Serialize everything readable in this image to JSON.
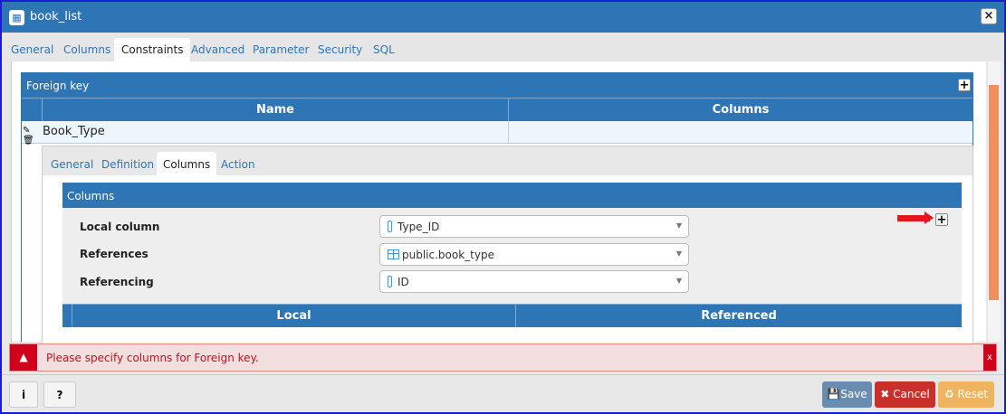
{
  "window": {
    "title": "book_list",
    "close": "×"
  },
  "tabs": [
    "General",
    "Columns",
    "Constraints",
    "Advanced",
    "Parameter",
    "Security",
    "SQL"
  ],
  "foreign_key": {
    "title": "Foreign key",
    "add": "+",
    "headers": [
      "Name",
      "Columns"
    ],
    "rows": [
      {
        "name": "Book_Type",
        "columns": ""
      }
    ]
  },
  "sub_tabs": [
    "General",
    "Definition",
    "Columns",
    "Action"
  ],
  "columns_panel": {
    "title": "Columns",
    "add": "+",
    "fields": [
      {
        "label": "Local column",
        "value": "Type_ID"
      },
      {
        "label": "References",
        "value": "public.book_type"
      },
      {
        "label": "Referencing",
        "value": "ID"
      }
    ],
    "headers": [
      "Local",
      "Referenced"
    ]
  },
  "alert": {
    "message": "Please specify columns for Foreign key.",
    "close": "x"
  },
  "footer": {
    "info": "i",
    "help": "?",
    "save": "Save",
    "cancel": "Cancel",
    "reset": "Reset"
  }
}
